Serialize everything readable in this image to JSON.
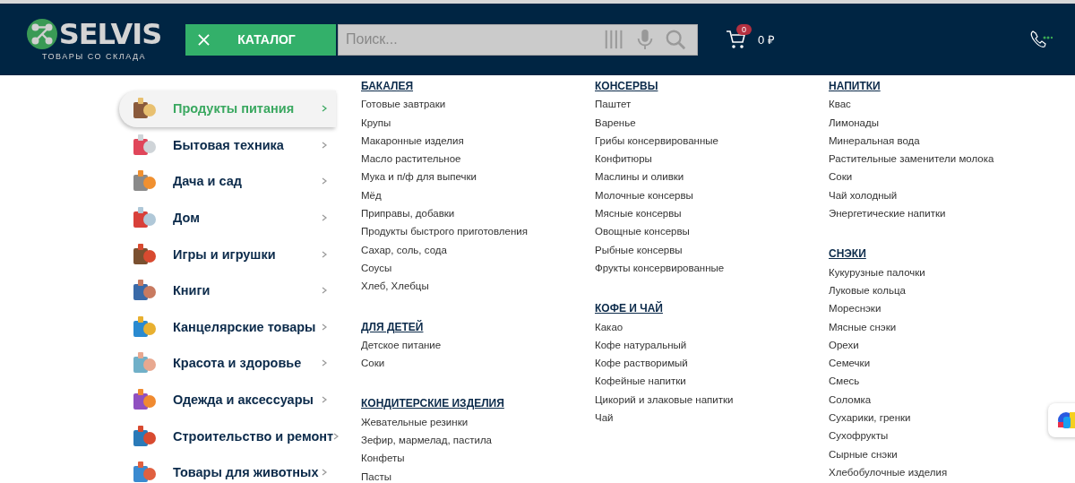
{
  "header": {
    "logo": {
      "name": "SELVIS",
      "tagline": "ТОВАРЫ СО СКЛАДА"
    },
    "catalog_button": "КАТАЛОГ",
    "search": {
      "placeholder": "Поиск..."
    },
    "cart": {
      "count": "0",
      "total": "0 ₽"
    }
  },
  "sidebar": {
    "items": [
      {
        "label": "Продукты питания",
        "selected": true
      },
      {
        "label": "Бытовая техника",
        "selected": false
      },
      {
        "label": "Дача и сад",
        "selected": false
      },
      {
        "label": "Дом",
        "selected": false
      },
      {
        "label": "Игры и игрушки",
        "selected": false
      },
      {
        "label": "Книги",
        "selected": false
      },
      {
        "label": "Канцелярские товары",
        "selected": false
      },
      {
        "label": "Красота и здоровье",
        "selected": false
      },
      {
        "label": "Одежда и аксессуары",
        "selected": false
      },
      {
        "label": "Строительство и ремонт",
        "selected": false
      },
      {
        "label": "Товары для животных",
        "selected": false
      }
    ]
  },
  "menu": {
    "columns": [
      {
        "groups": [
          {
            "title": "БАКАЛЕЯ",
            "items": [
              "Готовые завтраки",
              "Крупы",
              "Макаронные изделия",
              "Масло растительное",
              "Мука и п/ф для выпечки",
              "Мёд",
              "Приправы, добавки",
              "Продукты быстрого приготовления",
              "Сахар, соль, сода",
              "Соусы",
              "Хлеб, Хлебцы"
            ]
          },
          {
            "title": "ДЛЯ ДЕТЕЙ",
            "items": [
              "Детское питание",
              "Соки"
            ]
          },
          {
            "title": "КОНДИТЕРСКИЕ ИЗДЕЛИЯ",
            "items": [
              "Жевательные резинки",
              "Зефир, мармелад, пастила",
              "Конфеты",
              "Пасты"
            ]
          }
        ]
      },
      {
        "groups": [
          {
            "title": "КОНСЕРВЫ",
            "items": [
              "Паштет",
              "Варенье",
              "Грибы консервированные",
              "Конфитюры",
              "Маслины и оливки",
              "Молочные консервы",
              "Мясные консервы",
              "Овощные консервы",
              "Рыбные консервы",
              "Фрукты консервированные"
            ]
          },
          {
            "title": "КОФЕ И ЧАЙ",
            "items": [
              "Какао",
              "Кофе натуральный",
              "Кофе растворимый",
              "Кофейные напитки",
              "Цикорий и злаковые напитки",
              "Чай"
            ]
          }
        ]
      },
      {
        "groups": [
          {
            "title": "НАПИТКИ",
            "items": [
              "Квас",
              "Лимонады",
              "Минеральная вода",
              "Растительные заменители молока",
              "Соки",
              "Чай холодный",
              "Энергетические напитки"
            ]
          },
          {
            "title": "СНЭКИ",
            "items": [
              "Кукурузные палочки",
              "Луковые кольца",
              "Мореснэки",
              "Мясные снэки",
              "Орехи",
              "Семечки",
              "Смесь",
              "Соломка",
              "Сухарики, гренки",
              "Сухофрукты",
              "Сырные снэки",
              "Хлебобулочные изделия"
            ]
          }
        ]
      }
    ]
  }
}
